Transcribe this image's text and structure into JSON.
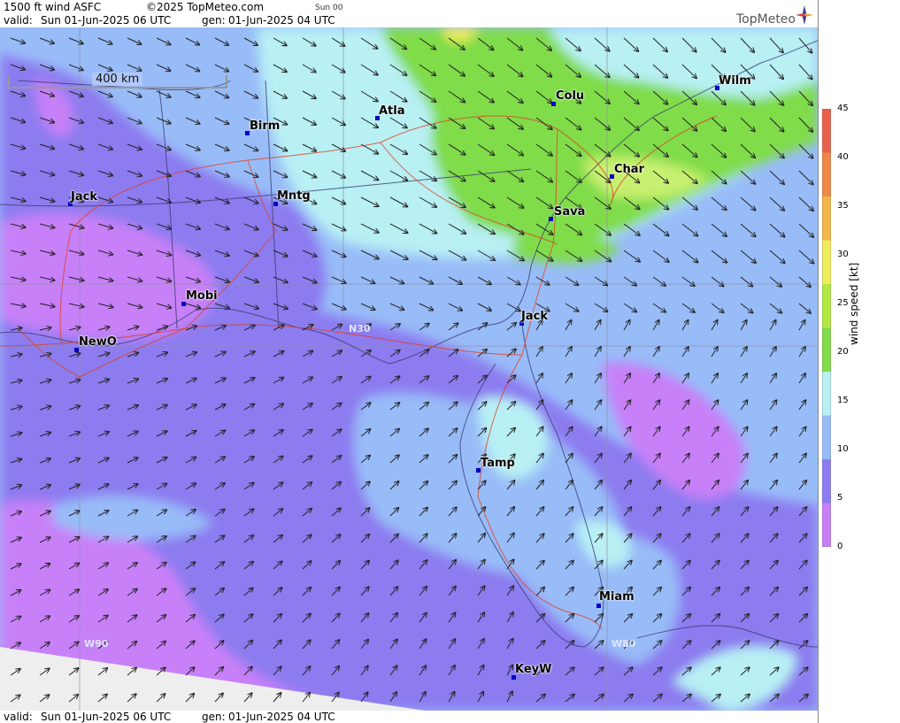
{
  "header": {
    "product": "1500 ft wind ASFC",
    "copyright": "©2025 TopMeteo.com",
    "day_code": "Sun 00",
    "valid_label": "valid:",
    "valid_value": "Sun  01-Jun-2025  06 UTC",
    "gen_label": "gen:",
    "gen_value": "01-Jun-2025 04 UTC"
  },
  "logo": {
    "text": "TopMeteo",
    "icon": "compass-star-icon"
  },
  "footer": {
    "valid_label": "valid:",
    "valid_value": "Sun  01-Jun-2025  06 UTC",
    "gen_label": "gen:",
    "gen_value": "01-Jun-2025 04 UTC"
  },
  "scale": {
    "label": "400 km"
  },
  "grid_labels": {
    "n30": "N30",
    "w90": "W90",
    "w80": "W80"
  },
  "cities": [
    "Birm",
    "Atla",
    "Colu",
    "Wilm",
    "Char",
    "Jack",
    "Mntg",
    "Sava",
    "Mobi",
    "Jack",
    "NewO",
    "Tamp",
    "Miam",
    "KeyW"
  ],
  "colorbar": {
    "title": "wind speed [kt]",
    "ticks": [
      "45",
      "40",
      "35",
      "30",
      "25",
      "20",
      "15",
      "10",
      "5",
      "0"
    ],
    "colors": [
      "#e8604c",
      "#f08848",
      "#f4b848",
      "#f0ee58",
      "#b0e840",
      "#80dc48",
      "#b8f0f4",
      "#98bcf8",
      "#8c7cf0",
      "#c880f8"
    ]
  }
}
